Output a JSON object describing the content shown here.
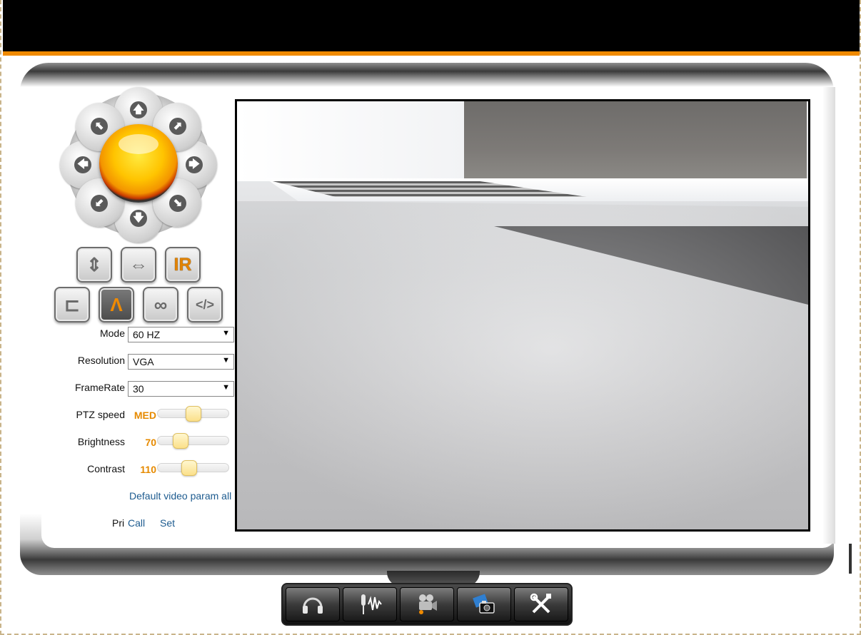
{
  "ptz": {
    "arrows": {
      "up": "🡅",
      "down": "🡇",
      "left": "🡄",
      "right": "🡆",
      "up_left": "⬉",
      "up_right": "⬈",
      "down_left": "⬋",
      "down_right": "⬊"
    }
  },
  "buttons": {
    "vertical_flip": "⇕",
    "horizontal_flip": "⇔",
    "ir": "IR",
    "arrow_left_panel": "⊏",
    "mountain": "Λ",
    "infinity": "∞",
    "code": "</>"
  },
  "settings": {
    "mode": {
      "label": "Mode",
      "value": "60 HZ"
    },
    "resolution": {
      "label": "Resolution",
      "value": "VGA"
    },
    "framerate": {
      "label": "FrameRate",
      "value": "30"
    },
    "ptz_speed": {
      "label": "PTZ speed",
      "value": "MED",
      "level": 0.5
    },
    "brightness": {
      "label": "Brightness",
      "value": "70",
      "level": 0.27
    },
    "contrast": {
      "label": "Contrast",
      "value": "110",
      "level": 0.43
    }
  },
  "links": {
    "default_video_param": "Default video param all",
    "pri": "Pri",
    "call": "Call",
    "set": "Set"
  },
  "toolbar": {
    "icons": [
      "headphones-icon",
      "microphone-icon",
      "video-camera-icon",
      "snapshot-camera-icon",
      "tools-icon"
    ]
  },
  "colors": {
    "accent": "#f08a00",
    "value_text": "#e68a00",
    "link": "#1d5b8f"
  }
}
